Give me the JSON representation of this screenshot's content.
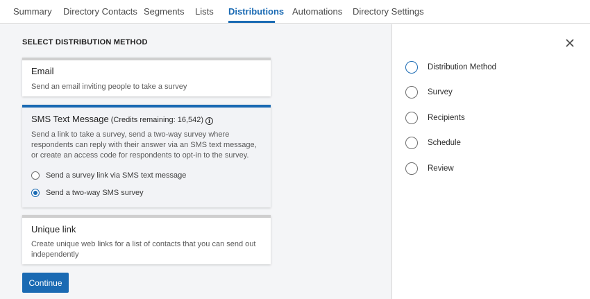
{
  "tabs": [
    {
      "label": "Summary"
    },
    {
      "label": "Directory Contacts"
    },
    {
      "label": "Segments"
    },
    {
      "label": "Lists"
    },
    {
      "label": "Distributions",
      "active": true
    },
    {
      "label": "Automations"
    },
    {
      "label": "Directory Settings"
    }
  ],
  "main": {
    "section_title": "SELECT DISTRIBUTION METHOD",
    "cards": [
      {
        "title": "Email",
        "description": "Send an email inviting people to take a survey"
      },
      {
        "title": "SMS Text Message",
        "credits": "(Credits remaining: 16,542)",
        "info_icon": "info-icon",
        "description": "Send a link to take a survey, send a two-way survey where respondents can reply with their answer via an SMS text message, or create an access code for respondents to opt-in to the survey.",
        "options": [
          {
            "label": "Send a survey link via SMS text message",
            "checked": false
          },
          {
            "label": "Send a two-way SMS survey",
            "checked": true
          }
        ]
      },
      {
        "title": "Unique link",
        "description": "Create unique web links for a list of contacts that you can send out independently"
      }
    ],
    "continue_label": "Continue"
  },
  "side_panel": {
    "close_icon": "close-icon",
    "steps": [
      {
        "label": "Distribution Method",
        "active": true
      },
      {
        "label": "Survey"
      },
      {
        "label": "Recipients"
      },
      {
        "label": "Schedule"
      },
      {
        "label": "Review"
      }
    ]
  },
  "colors": {
    "accent": "#1a6ab3",
    "panel_bg": "#f4f5f7"
  }
}
